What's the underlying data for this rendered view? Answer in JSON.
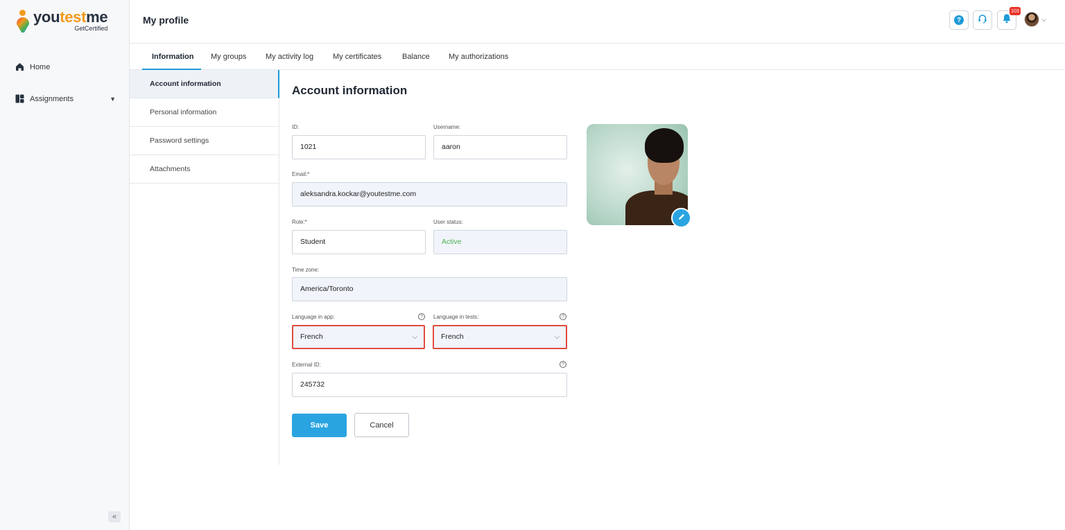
{
  "brand": {
    "logo_you": "you",
    "logo_test": "test",
    "logo_me": "me",
    "logo_sub": "GetCertified"
  },
  "sidebar": {
    "items": [
      {
        "label": "Home",
        "icon": "home-icon"
      },
      {
        "label": "Assignments",
        "icon": "assignments-icon"
      }
    ],
    "collapse_label": "«"
  },
  "header": {
    "title": "My profile",
    "help_glyph": "?",
    "notifications_count": "103"
  },
  "tabs": [
    "Information",
    "My groups",
    "My activity log",
    "My certificates",
    "Balance",
    "My authorizations"
  ],
  "submenu": [
    "Account information",
    "Personal information",
    "Password settings",
    "Attachments"
  ],
  "form": {
    "title": "Account information",
    "id_label": "ID:",
    "id_value": "1021",
    "username_label": "Username:",
    "username_value": "aaron",
    "email_label": "Email:*",
    "email_value": "aleksandra.kockar@youtestme.com",
    "role_label": "Role:*",
    "role_value": "Student",
    "status_label": "User status:",
    "status_value": "Active",
    "timezone_label": "Time zone:",
    "timezone_value": "America/Toronto",
    "lang_app_label": "Language in app:",
    "lang_app_value": "French",
    "lang_tests_label": "Language in tests:",
    "lang_tests_value": "French",
    "external_id_label": "External ID:",
    "external_id_value": "245732",
    "save_label": "Save",
    "cancel_label": "Cancel"
  },
  "colors": {
    "accent": "#2aa4e1",
    "highlight_border": "#e04a3f",
    "status_active": "#4caf50"
  }
}
